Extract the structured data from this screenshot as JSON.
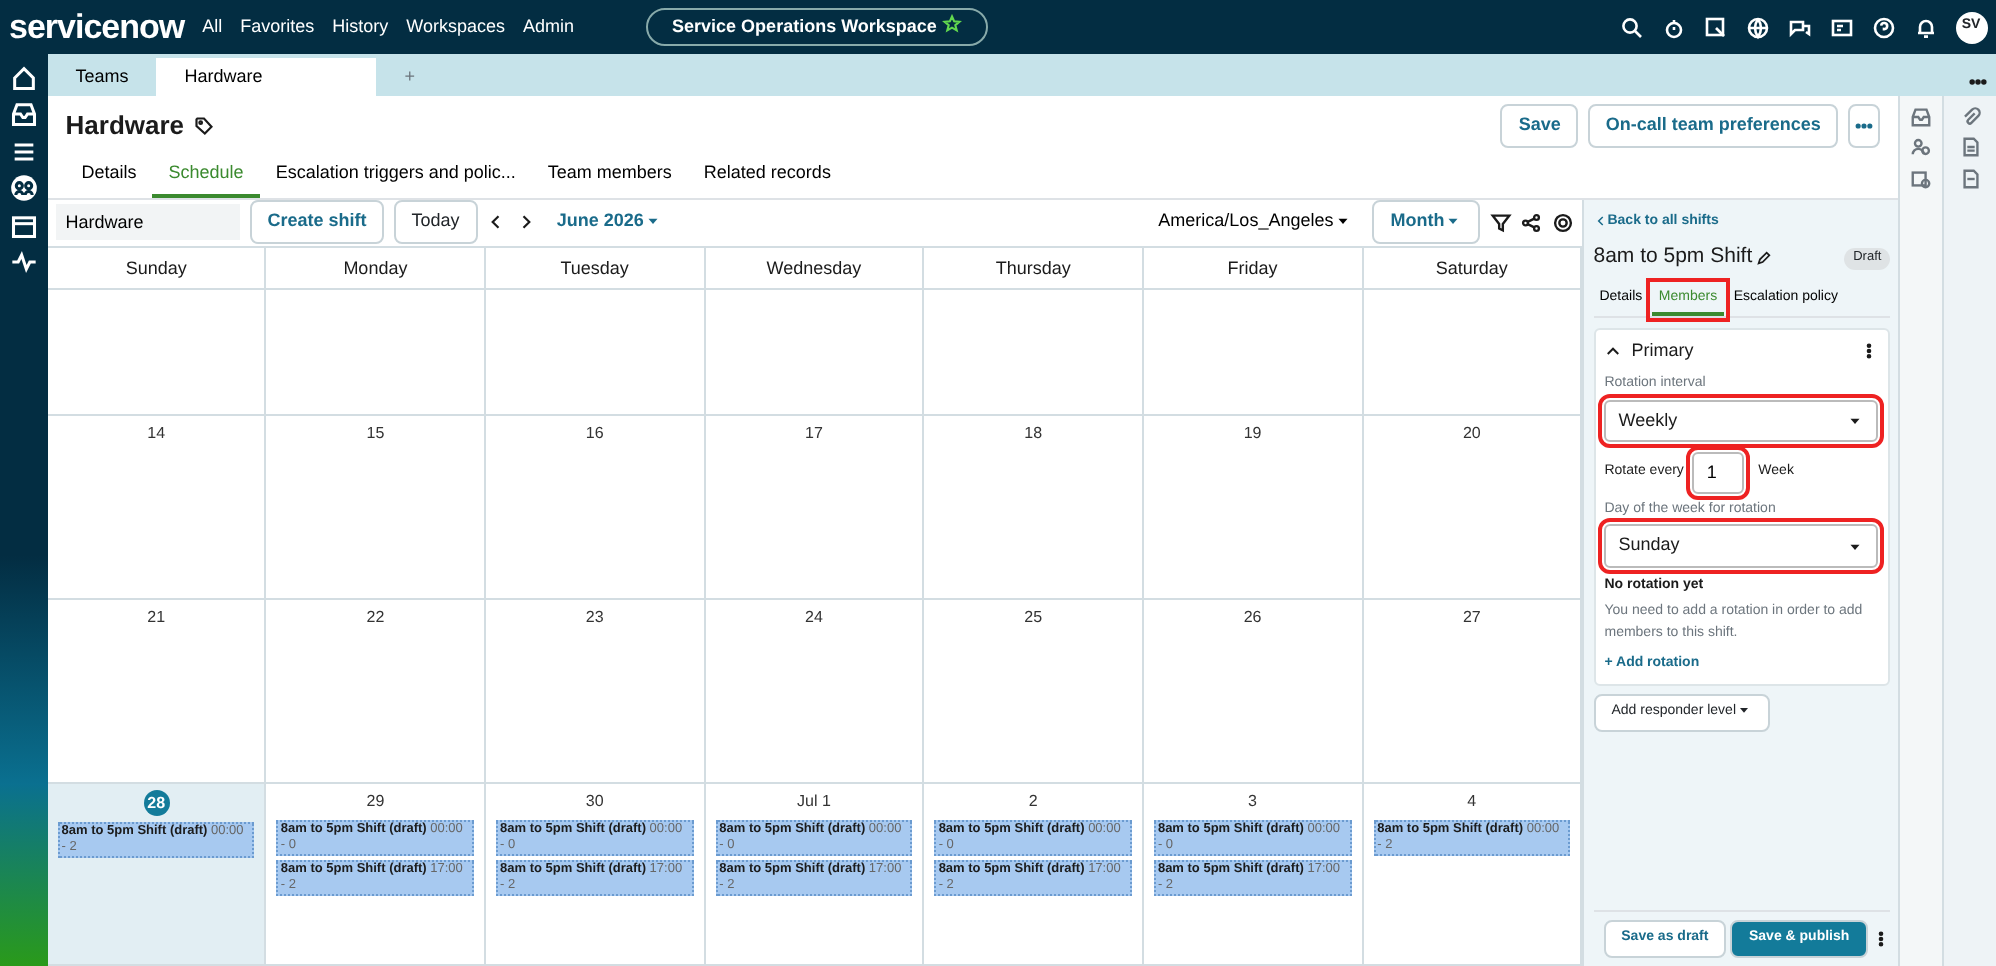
{
  "top_nav": {
    "logo": "servicenow",
    "menu": [
      "All",
      "Favorites",
      "History",
      "Workspaces",
      "Admin"
    ],
    "workspace": "Service Operations Workspace",
    "avatar": "SV"
  },
  "workspace_tabs": [
    {
      "label": "Teams",
      "selected": false
    },
    {
      "label": "Hardware",
      "selected": true
    }
  ],
  "new_tab": "+",
  "record": {
    "title": "Hardware",
    "buttons": [
      "Save",
      "On-call team preferences"
    ]
  },
  "record_tabs": [
    {
      "label": "Details",
      "selected": false
    },
    {
      "label": "Schedule",
      "selected": true
    },
    {
      "label": "Escalation triggers and polic...",
      "selected": false
    },
    {
      "label": "Team members",
      "selected": false
    },
    {
      "label": "Related records",
      "selected": false
    }
  ],
  "toolbar": {
    "search_value": "Hardware",
    "create": "Create shift",
    "today": "Today",
    "month": "June 2026",
    "timezone": "America/Los_Angeles",
    "view": "Month"
  },
  "calendar": {
    "weekdays": [
      "Sunday",
      "Monday",
      "Tuesday",
      "Wednesday",
      "Thursday",
      "Friday",
      "Saturday"
    ],
    "weeks": [
      {
        "days": [
          {
            "today": false
          },
          {
            "today": false
          },
          {
            "today": false
          },
          {
            "today": false
          },
          {
            "today": false
          },
          {
            "today": false
          },
          {
            "today": false
          }
        ]
      },
      {
        "days": [
          {
            "date": "14",
            "today": false
          },
          {
            "date": "15",
            "today": false
          },
          {
            "date": "16",
            "today": false
          },
          {
            "date": "17",
            "today": false
          },
          {
            "date": "18",
            "today": false
          },
          {
            "date": "19",
            "today": false
          },
          {
            "date": "20",
            "today": false
          }
        ]
      },
      {
        "days": [
          {
            "date": "21",
            "today": false
          },
          {
            "date": "22",
            "today": false
          },
          {
            "date": "23",
            "today": false
          },
          {
            "date": "24",
            "today": false
          },
          {
            "date": "25",
            "today": false
          },
          {
            "date": "26",
            "today": false
          },
          {
            "date": "27",
            "today": false
          }
        ]
      },
      {
        "days": [
          {
            "date": "28",
            "today": true,
            "shifts": [
              {
                "title": "8am to 5pm Shift (draft)",
                "time": "00:00 - 2"
              }
            ]
          },
          {
            "date": "29",
            "today": false,
            "shifts": [
              {
                "title": "8am to 5pm Shift (draft)",
                "time": "00:00 - 0"
              },
              {
                "title": "8am to 5pm Shift (draft)",
                "time": "17:00 - 2"
              }
            ]
          },
          {
            "date": "30",
            "today": false,
            "shifts": [
              {
                "title": "8am to 5pm Shift (draft)",
                "time": "00:00 - 0"
              },
              {
                "title": "8am to 5pm Shift (draft)",
                "time": "17:00 - 2"
              }
            ]
          },
          {
            "date": "Jul 1",
            "today": false,
            "shifts": [
              {
                "title": "8am to 5pm Shift (draft)",
                "time": "00:00 - 0"
              },
              {
                "title": "8am to 5pm Shift (draft)",
                "time": "17:00 - 2"
              }
            ]
          },
          {
            "date": "2",
            "today": false,
            "shifts": [
              {
                "title": "8am to 5pm Shift (draft)",
                "time": "00:00 - 0"
              },
              {
                "title": "8am to 5pm Shift (draft)",
                "time": "17:00 - 2"
              }
            ]
          },
          {
            "date": "3",
            "today": false,
            "shifts": [
              {
                "title": "8am to 5pm Shift (draft)",
                "time": "00:00 - 0"
              },
              {
                "title": "8am to 5pm Shift (draft)",
                "time": "17:00 - 2"
              }
            ]
          },
          {
            "date": "4",
            "today": false,
            "shifts": [
              {
                "title": "8am to 5pm Shift (draft)",
                "time": "00:00 - 2"
              }
            ]
          }
        ]
      }
    ]
  },
  "shift_panel": {
    "back": "Back to all shifts",
    "title": "8am to 5pm Shift",
    "badge": "Draft",
    "tabs": [
      {
        "label": "Details",
        "selected": false,
        "highlighted": false
      },
      {
        "label": "Members",
        "selected": true,
        "highlighted": true
      },
      {
        "label": "Escalation policy",
        "selected": false,
        "highlighted": false
      }
    ],
    "section": "Primary",
    "rotation_interval": {
      "label": "Rotation interval",
      "value": "Weekly",
      "highlighted": true
    },
    "rotate_every": {
      "label": "Rotate every",
      "value": "1",
      "unit": "Week",
      "highlighted": true
    },
    "rotation_day": {
      "label": "Day of the week for rotation",
      "value": "Sunday",
      "highlighted": true
    },
    "empty_title": "No rotation yet",
    "empty_text": "You need to add a rotation in order to add members to this shift.",
    "add_rotation": "+ Add rotation",
    "add_level": "Add responder level",
    "footer_buttons": [
      "Save as draft",
      "Save & publish"
    ]
  }
}
